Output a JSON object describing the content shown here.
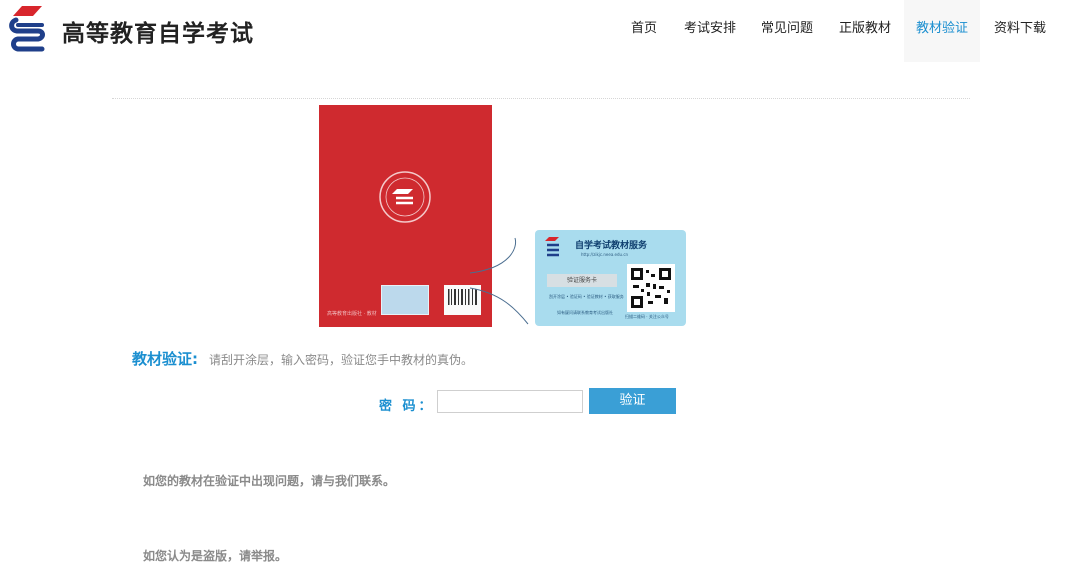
{
  "header": {
    "site_title": "高等教育自学考试",
    "logo_icon": "exam-logo-icon",
    "nav": [
      {
        "label": "首页",
        "active": false
      },
      {
        "label": "考试安排",
        "active": false
      },
      {
        "label": "常见问题",
        "active": false
      },
      {
        "label": "正版教材",
        "active": false
      },
      {
        "label": "教材验证",
        "active": true
      },
      {
        "label": "资料下载",
        "active": false
      }
    ]
  },
  "illustration": {
    "card_title": "自学考试教材服务",
    "card_url": "http://zikjc.neea.edu.cn",
    "card_label": "验证服务卡",
    "card_sub": "刮开涂层 • 验证码 • 验证教材 • 获取服务",
    "card_foot_left": "如有疑问请联系教育考试出版社",
    "card_foot_right": "扫描二维码 · 关注公众号",
    "book_foot": "高等教育出版社  · 教材",
    "colors": {
      "book_red": "#cf2a2f",
      "card_blue": "#a9dcee"
    }
  },
  "verify": {
    "heading": "教材验证:",
    "hint": "请刮开涂层，输入密码，验证您手中教材的真伪。",
    "password_label": "密 码：",
    "password_value": "",
    "password_placeholder": "",
    "button_label": "验证",
    "accent": "#1b8fd0"
  },
  "footer_notes": {
    "contact": "如您的教材在验证中出现问题，请与我们联系。",
    "piracy": "如您认为是盗版，请举报。"
  }
}
